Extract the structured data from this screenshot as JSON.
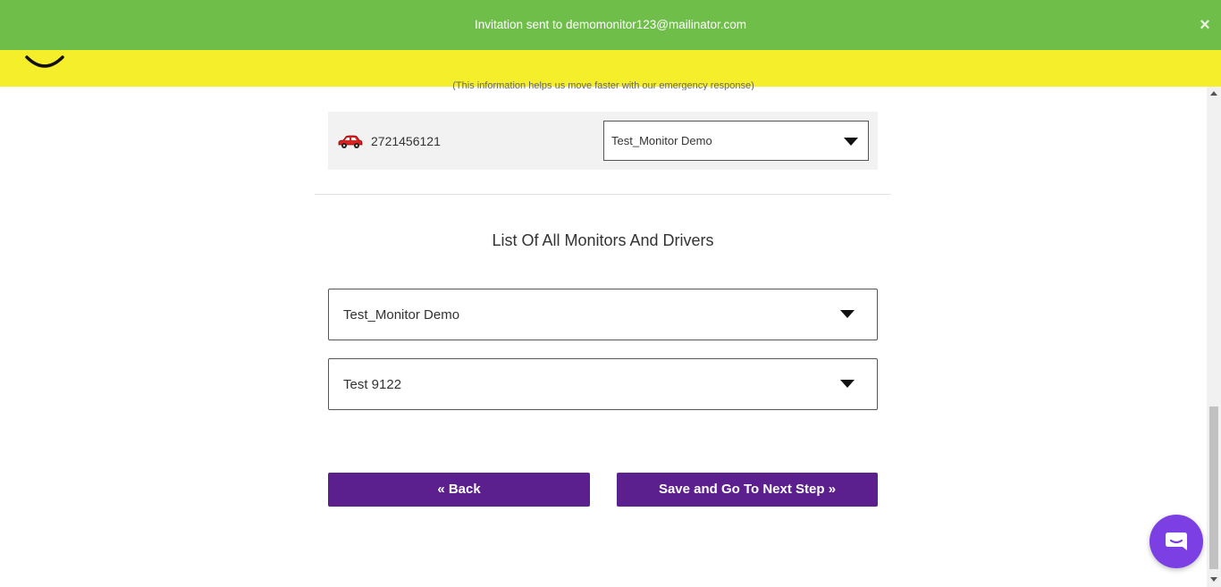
{
  "notification": {
    "message": "Invitation sent to demomonitor123@mailinator.com",
    "close_label": "×",
    "color": "#6fbe4a"
  },
  "header": {
    "color": "#f5ee2b",
    "logo_icon": "smiley-logo-icon"
  },
  "hint_text": "(This information helps us move faster with our emergency response)",
  "vehicle": {
    "icon": "car-icon",
    "number": "2721456121",
    "assigned_monitor": "Test_Monitor Demo"
  },
  "section": {
    "title": "List Of All Monitors And Drivers"
  },
  "monitor_select": {
    "value": "Test_Monitor Demo"
  },
  "driver_select": {
    "value": "Test 9122"
  },
  "buttons": {
    "back_label": "« Back",
    "next_label": "Save and Go To Next Step »",
    "color": "#5c1f8e"
  },
  "chat": {
    "icon": "chat-icon",
    "color": "#7b3fe4"
  }
}
